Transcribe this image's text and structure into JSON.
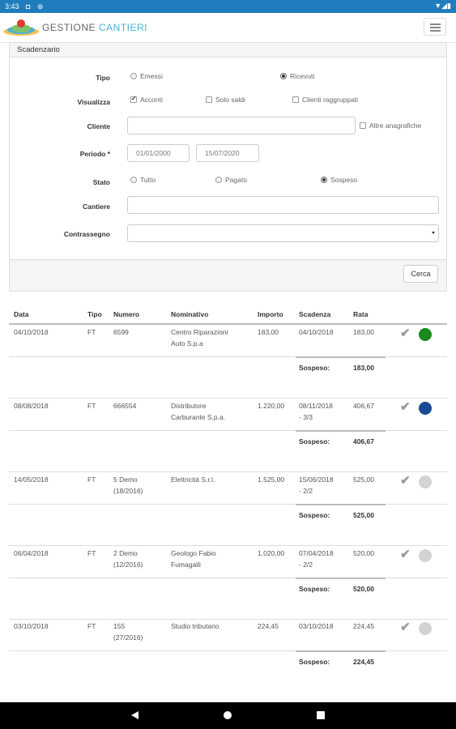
{
  "status_bar": {
    "time": "3:43",
    "left_icons": "◘ ⊛",
    "right_icons": "▼◢▮"
  },
  "app": {
    "brand_part1": "GESTIONE",
    "brand_part2": "CANTIERI",
    "menu_icon": "hamburger-icon"
  },
  "filter_panel": {
    "title": "Scadenzario",
    "tipo": {
      "label": "Tipo",
      "options": [
        "Emessi",
        "Ricevuti"
      ],
      "selected": "Ricevuti"
    },
    "visualizza": {
      "label": "Visualizza",
      "options": [
        "Acconti",
        "Solo saldi",
        "Clienti raggruppati"
      ],
      "checked": [
        "Acconti"
      ]
    },
    "cliente": {
      "label": "Cliente",
      "value": "",
      "altre_label": "Altre anagrafiche"
    },
    "periodo": {
      "label": "Periodo *",
      "from": "01/01/2000",
      "to": "15/07/2020"
    },
    "stato": {
      "label": "Stato",
      "options": [
        "Tutto",
        "Pagato",
        "Sospeso"
      ],
      "selected": "Sospeso"
    },
    "cantiere": {
      "label": "Cantiere",
      "value": ""
    },
    "contrassegno": {
      "label": "Contrassegno",
      "value": ""
    },
    "search_button": "Cerca"
  },
  "table": {
    "headers": [
      "Data",
      "Tipo",
      "Numero",
      "Nominativo",
      "Importo",
      "Scadenza",
      "Rata"
    ],
    "sospeso_label": "Sospeso:",
    "rows": [
      {
        "data": "04/10/2018",
        "tipo": "FT",
        "numero_line1": "6599",
        "numero_line2": "",
        "nominativo_line1": "Centro Riparazioni",
        "nominativo_line2": "Auto S.p.a",
        "importo": "183,00",
        "scadenza_line1": "04/10/2018",
        "scadenza_line2": "",
        "rata": "183,00",
        "sospeso": "183,00",
        "status_color": "#1a8a1a"
      },
      {
        "data": "08/08/2018",
        "tipo": "FT",
        "numero_line1": "666554",
        "numero_line2": "",
        "nominativo_line1": "Distributore",
        "nominativo_line2": "Carburante S.p.a.",
        "importo": "1.220,00",
        "scadenza_line1": "08/11/2018",
        "scadenza_line2": "- 3/3",
        "rata": "406,67",
        "sospeso": "406,67",
        "status_color": "#1a4a94"
      },
      {
        "data": "14/05/2018",
        "tipo": "FT",
        "numero_line1": "5 Demo",
        "numero_line2": "(18/2016)",
        "nominativo_line1": "Elettricità S.r.l.",
        "nominativo_line2": "",
        "importo": "1.525,00",
        "scadenza_line1": "15/06/2018",
        "scadenza_line2": "- 2/2",
        "rata": "525,00",
        "sospeso": "525,00",
        "status_color": "#d3d3d3"
      },
      {
        "data": "06/04/2018",
        "tipo": "FT",
        "numero_line1": "2 Demo",
        "numero_line2": "(12/2016)",
        "nominativo_line1": "Geologo Fabio",
        "nominativo_line2": "Fumagalli",
        "importo": "1.020,00",
        "scadenza_line1": "07/04/2018",
        "scadenza_line2": "- 2/2",
        "rata": "520,00",
        "sospeso": "520,00",
        "status_color": "#d3d3d3"
      },
      {
        "data": "03/10/2018",
        "tipo": "FT",
        "numero_line1": "155",
        "numero_line2": "(27/2016)",
        "nominativo_line1": "Studio tributario",
        "nominativo_line2": "",
        "importo": "224,45",
        "scadenza_line1": "03/10/2018",
        "scadenza_line2": "",
        "rata": "224,45",
        "sospeso": "224,45",
        "status_color": "#d3d3d3"
      }
    ]
  },
  "nav_bar": {
    "back_icon": "back-triangle-icon",
    "home_icon": "home-circle-icon",
    "recent_icon": "recents-square-icon"
  }
}
